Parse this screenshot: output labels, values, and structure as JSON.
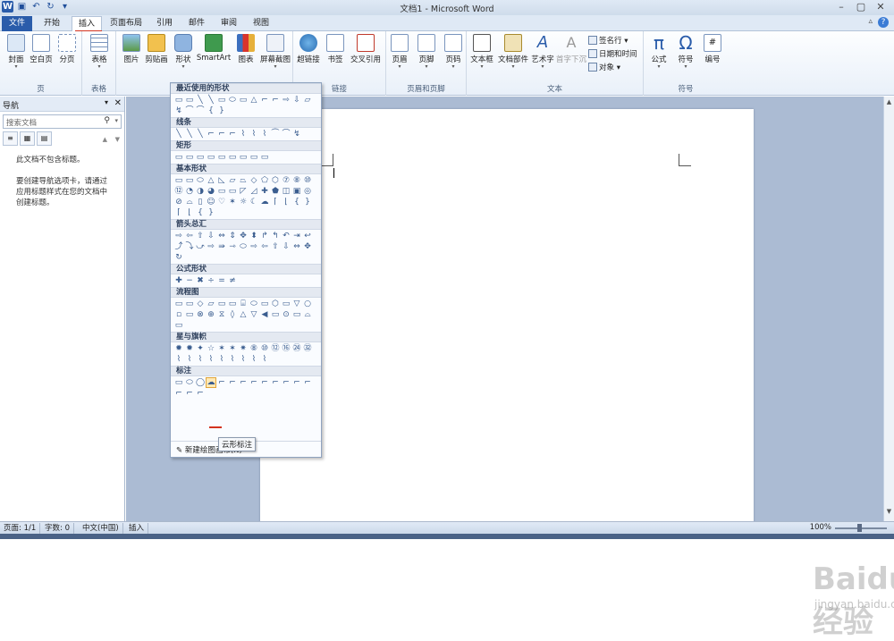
{
  "title": "文档1 - Microsoft Word",
  "tabs": [
    "文件",
    "开始",
    "插入",
    "页面布局",
    "引用",
    "邮件",
    "审阅",
    "视图"
  ],
  "ribbon": {
    "page_group": {
      "label": "页",
      "buttons": [
        "封面",
        "空白页",
        "分页"
      ]
    },
    "table_group": {
      "label": "表格",
      "buttons": [
        "表格"
      ]
    },
    "illustrations": {
      "buttons": [
        "图片",
        "剪贴画",
        "形状",
        "SmartArt",
        "图表",
        "屏幕截图"
      ]
    },
    "links": {
      "label": "链接",
      "buttons": [
        "超链接",
        "书签",
        "交叉引用"
      ]
    },
    "header_footer": {
      "label": "页眉和页脚",
      "buttons": [
        "页眉",
        "页脚",
        "页码"
      ]
    },
    "text": {
      "label": "文本",
      "buttons": [
        "文本框",
        "文档部件",
        "艺术字",
        "首字下沉"
      ],
      "small": [
        "签名行",
        "日期和时间",
        "对象"
      ]
    },
    "symbols": {
      "label": "符号",
      "buttons": [
        "公式",
        "符号",
        "编号"
      ]
    }
  },
  "nav": {
    "title": "导航",
    "search_placeholder": "搜索文档",
    "message_1": "此文档不包含标题。",
    "message_2": "要创建导航选项卡，请通过应用标题样式在您的文档中创建标题。"
  },
  "shapes_menu": {
    "sections": [
      {
        "name": "最近使用的形状",
        "shapes": [
          "▭",
          "▭",
          "╲",
          "╲",
          "▭",
          "⬭",
          "▭",
          "△",
          "⌐",
          "⌐",
          "⇨",
          "⇩",
          "▱",
          "↯",
          "⌒",
          "⌒",
          "{",
          "}"
        ]
      },
      {
        "name": "线条",
        "shapes": [
          "╲",
          "╲",
          "╲",
          "⌐",
          "⌐",
          "⌐",
          "⌇",
          "⌇",
          "⌇",
          "⏜",
          "⌒",
          "↯"
        ]
      },
      {
        "name": "矩形",
        "shapes": [
          "▭",
          "▭",
          "▭",
          "▭",
          "▭",
          "▭",
          "▭",
          "▭",
          "▭"
        ]
      },
      {
        "name": "基本形状",
        "shapes": [
          "▭",
          "▭",
          "⬭",
          "△",
          "◺",
          "▱",
          "⏢",
          "◇",
          "⬠",
          "⬡",
          "⑦",
          "⑧",
          "⑩",
          "⑫",
          "◔",
          "◑",
          "◕",
          "▭",
          "▭",
          "◸",
          "◿",
          "✚",
          "⬟",
          "◫",
          "▣",
          "◎",
          "⊘",
          "⌓",
          "▯",
          "☺",
          "♡",
          "✶",
          "☼",
          "☾",
          "☁",
          "⌈",
          "⌊",
          "{",
          "}",
          "⌈",
          "⌊",
          "{",
          "}"
        ]
      },
      {
        "name": "箭头总汇",
        "shapes": [
          "⇨",
          "⇦",
          "⇧",
          "⇩",
          "⇔",
          "⇕",
          "✥",
          "⬍",
          "↱",
          "↰",
          "↶",
          "⇥",
          "↩",
          "⤴",
          "⤵",
          "⤻",
          "⇨",
          "⇛",
          "⇾",
          "⬭",
          "⇨",
          "⇦",
          "⇧",
          "⇩",
          "⇔",
          "✥",
          "↻"
        ]
      },
      {
        "name": "公式形状",
        "shapes": [
          "✚",
          "−",
          "✖",
          "÷",
          "=",
          "≠"
        ]
      },
      {
        "name": "流程图",
        "shapes": [
          "▭",
          "▭",
          "◇",
          "▱",
          "▭",
          "▭",
          "⌸",
          "⬭",
          "▭",
          "⬡",
          "▭",
          "▽",
          "○",
          "▫",
          "▭",
          "⊗",
          "⊕",
          "⧖",
          "◊",
          "△",
          "▽",
          "◀",
          "▭",
          "⊙",
          "▭",
          "⌓",
          "▭"
        ]
      },
      {
        "name": "星与旗帜",
        "shapes": [
          "✹",
          "✹",
          "✦",
          "☆",
          "✶",
          "✶",
          "✷",
          "⑧",
          "⑩",
          "⑫",
          "⑯",
          "㉔",
          "㉜",
          "⌇",
          "⌇",
          "⌇",
          "⌇",
          "⌇",
          "⌇",
          "⌇",
          "⌇",
          "⌇"
        ]
      },
      {
        "name": "标注",
        "shapes": [
          "▭",
          "⬭",
          "◯",
          "☁",
          "⌐",
          "⌐",
          "⌐",
          "⌐",
          "⌐",
          "⌐",
          "⌐",
          "⌐",
          "⌐",
          "⌐",
          "⌐",
          "⌐"
        ]
      }
    ],
    "footer": "新建绘图画布(N)",
    "tooltip": "云形标注"
  },
  "status": {
    "page": "页面: 1/1",
    "words": "字数: 0",
    "lang": "中文(中国)",
    "mode": "插入",
    "zoom": "100%"
  },
  "watermark": "Baidu经验",
  "watermark_url": "jingyan.baidu.com"
}
